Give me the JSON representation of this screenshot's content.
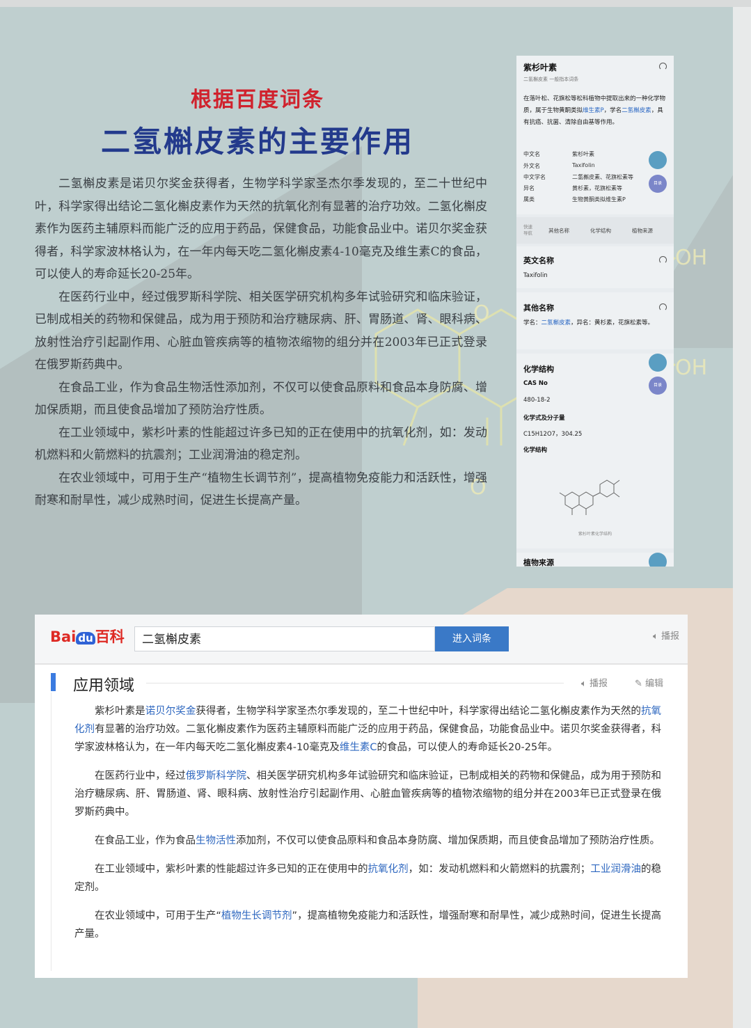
{
  "header": {
    "subtitle": "根据百度词条",
    "title": "二氢槲皮素的主要作用"
  },
  "article": {
    "paragraphs": [
      "二氢槲皮素是诺贝尔奖金获得者，生物学科学家圣杰尔季发现的，至二十世纪中叶，科学家得出结论二氢化槲皮素作为天然的抗氧化剂有显著的治疗功效。二氢化槲皮素作为医药主辅原料而能广泛的应用于药品，保健食品，功能食品业中。诺贝尔奖金获得者，科学家波林格认为，在一年内每天吃二氢化槲皮素4-10毫克及维生素C的食品，可以使人的寿命延长20-25年。",
      "在医药行业中，经过俄罗斯科学院、相关医学研究机构多年试验研究和临床验证，已制成相关的药物和保健品，成为用于预防和治疗糖尿病、肝、胃肠道、肾、眼科病、放射性治疗引起副作用、心脏血管疾病等的植物浓缩物的组分并在2003年已正式登录在俄罗斯药典中。",
      "在食品工业，作为食品生物活性添加剂，不仅可以使食品原料和食品本身防腐、增加保质期，而且使食品增加了预防治疗性质。",
      "在工业领域中，紫杉叶素的性能超过许多已知的正在使用中的抗氧化剂，如：发动机燃料和火箭燃料的抗震剂；工业润滑油的稳定剂。",
      "在农业领域中，可用于生产“植物生长调节剂”，提高植物免疫能力和活跃性，增强耐寒和耐旱性，减少成熟时间，促进生长提高产量。"
    ]
  },
  "mobile_card": {
    "name": "紫杉叶素",
    "tagline": "二氢槲皮素 一般指本词条",
    "summary_pre": "在落叶松、花旗松等松科植物中提取出来的一种化学物质，属于生物黄酮类拟",
    "summary_link1": "维生素P",
    "summary_mid": "，学名",
    "summary_link2": "二氢槲皮素",
    "summary_post": "，具有抗癌、抗菌、清除自由基等作用。",
    "info": [
      {
        "k": "中文名",
        "v": "紫杉叶素"
      },
      {
        "k": "外文名",
        "v": "Taxifolin"
      },
      {
        "k": "中文学名",
        "v": "二氢槲皮素、花旗松素等"
      },
      {
        "k": "异名",
        "v": "黄杉素，花旗松素等"
      },
      {
        "k": "属类",
        "v": "生物黄酮类拟维生素P"
      }
    ],
    "fab_label": "目录",
    "nav_label": "快速导航",
    "nav_items": [
      "其他名称",
      "化学结构",
      "植物来源"
    ],
    "english_title": "英文名称",
    "english_value": "Taxifolin",
    "other_title": "其他名称",
    "other_pre": "学名：",
    "other_link": "二氢槲皮素",
    "other_post": "，异名：黄杉素，花旗松素等。",
    "chem_title": "化学结构",
    "cas_label": "CAS No",
    "cas_value": "480-18-2",
    "formula_label": "化学式及分子量",
    "formula_value": "C15H12O7，304.25",
    "structure_label": "化学结构",
    "structure_caption": "紫杉叶素化学结构",
    "source_title": "植物来源"
  },
  "baike": {
    "logo_bai": "Bai",
    "logo_du": "du",
    "logo_ke": "百科",
    "search_value": "二氢槲皮素",
    "enter_button": "进入词条",
    "top_play": "播报",
    "section_title": "应用领域",
    "play_label": "播报",
    "edit_label": "编辑",
    "p1": {
      "a": "紫杉叶素是",
      "l1": "诺贝尔奖金",
      "b": "获得者，生物学科学家圣杰尔季发现的，至二十世纪中叶，科学家得出结论二氢化槲皮素作为天然的",
      "l2": "抗氧化剂",
      "c": "有显著的治疗功效。二氢化槲皮素作为医药主辅原料而能广泛的应用于药品，保健食品，功能食品业中。诺贝尔奖金获得者，科学家波林格认为，在一年内每天吃二氢化槲皮素4-10毫克及",
      "l3": "维生素C",
      "d": "的食品，可以使人的寿命延长20-25年。"
    },
    "p2": {
      "a": "在医药行业中，经过",
      "l1": "俄罗斯科学院",
      "b": "、相关医学研究机构多年试验研究和临床验证，已制成相关的药物和保健品，成为用于预防和治疗糖尿病、肝、胃肠道、肾、眼科病、放射性治疗引起副作用、心脏血管疾病等的植物浓缩物的组分并在2003年已正式登录在俄罗斯药典中。"
    },
    "p3": {
      "a": "在食品工业，作为食品",
      "l1": "生物活性",
      "b": "添加剂，不仅可以使食品原料和食品本身防腐、增加保质期，而且使食品增加了预防治疗性质。"
    },
    "p4": {
      "a": "在工业领域中，紫杉叶素的性能超过许多已知的正在使用中的",
      "l1": "抗氧化剂",
      "b": "，如：发动机燃料和火箭燃料的抗震剂；",
      "l2": "工业润滑油",
      "c": "的稳定剂。"
    },
    "p5": {
      "a": "在农业领域中，可用于生产“",
      "l1": "植物生长调节剂",
      "b": "”，提高植物免疫能力和活跃性，增强耐寒和耐旱性，减少成熟时间，促进生长提高产量。"
    }
  },
  "watermark": {
    "oh": "OH",
    "o": "O",
    "h": "H"
  },
  "colors": {
    "title_red": "#d0222d",
    "title_blue": "#233a8c",
    "link_blue": "#2f68c0",
    "enter_button": "#3a79c7"
  }
}
